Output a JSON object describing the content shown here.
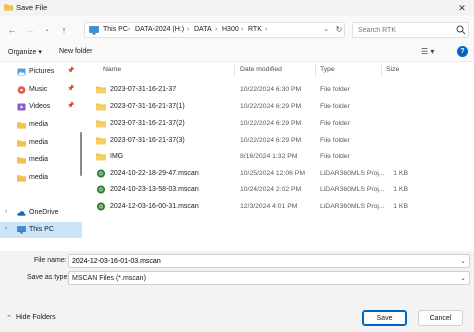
{
  "window": {
    "title": "Save File",
    "close_icon": "close-icon"
  },
  "address": {
    "crumbs": [
      "This PC",
      "DATA-2024 (H:)",
      "DATA",
      "H300",
      "RTK"
    ],
    "separator": "›"
  },
  "search": {
    "placeholder": "Search RTK"
  },
  "toolbar": {
    "organize_label": "Organize ▾",
    "new_folder_label": "New folder"
  },
  "nav": {
    "items": [
      {
        "label": "Pictures",
        "icon": "pictures-icon",
        "pinned": true
      },
      {
        "label": "Music",
        "icon": "music-icon",
        "pinned": true
      },
      {
        "label": "Videos",
        "icon": "videos-icon",
        "pinned": true
      },
      {
        "label": "media",
        "icon": "folder-icon",
        "pinned": false
      },
      {
        "label": "media",
        "icon": "folder-icon",
        "pinned": false
      },
      {
        "label": "media",
        "icon": "folder-icon",
        "pinned": false
      },
      {
        "label": "media",
        "icon": "folder-icon",
        "pinned": false
      },
      {
        "label": "OneDrive",
        "icon": "onedrive-icon",
        "pinned": false
      },
      {
        "label": "This PC",
        "icon": "pc-icon",
        "pinned": false,
        "selected": true
      }
    ]
  },
  "columns": {
    "name": "Name",
    "date": "Date modified",
    "type": "Type",
    "size": "Size"
  },
  "files": [
    {
      "name": "2023-07-31-16-21-37",
      "date": "10/22/2024 6:30 PM",
      "type": "File folder",
      "size": "",
      "kind": "folder"
    },
    {
      "name": "2023-07-31-16-21-37(1)",
      "date": "10/22/2024 6:29 PM",
      "type": "File folder",
      "size": "",
      "kind": "folder"
    },
    {
      "name": "2023-07-31-16-21-37(2)",
      "date": "10/22/2024 6:29 PM",
      "type": "File folder",
      "size": "",
      "kind": "folder"
    },
    {
      "name": "2023-07-31-16-21-37(3)",
      "date": "10/22/2024 6:29 PM",
      "type": "File folder",
      "size": "",
      "kind": "folder"
    },
    {
      "name": "IMG",
      "date": "8/16/2024 1:32 PM",
      "type": "File folder",
      "size": "",
      "kind": "folder"
    },
    {
      "name": "2024-10-22-18-29-47.mscan",
      "date": "10/25/2024 12:06 PM",
      "type": "LiDAR360MLS Proj...",
      "size": "1 KB",
      "kind": "mscan"
    },
    {
      "name": "2024-10-23-13-58-03.mscan",
      "date": "10/24/2024 2:02 PM",
      "type": "LiDAR360MLS Proj...",
      "size": "1 KB",
      "kind": "mscan"
    },
    {
      "name": "2024-12-03-16-00-31.mscan",
      "date": "12/3/2024 4:01 PM",
      "type": "LiDAR360MLS Proj...",
      "size": "1 KB",
      "kind": "mscan"
    }
  ],
  "bottom": {
    "file_name_label": "File name:",
    "file_name_value": "2024-12-03-16-01-03.mscan",
    "save_type_label": "Save as type:",
    "save_type_value": "MSCAN Files (*.mscan)",
    "hide_folders_label": "Hide Folders",
    "save_label": "Save",
    "cancel_label": "Cancel"
  },
  "colors": {
    "accent": "#0067c0",
    "folder": "#f2c14e",
    "selected": "#cce4f7"
  }
}
